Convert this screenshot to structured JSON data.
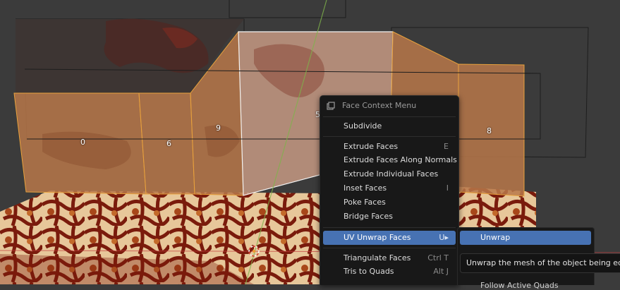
{
  "viewport": {
    "face_labels": [
      "0",
      "6",
      "9",
      "5",
      "8"
    ],
    "colors": {
      "selection": "#e0a040",
      "background": "#3b3b3b",
      "menu_bg": "#181818",
      "highlight": "#4772b3"
    }
  },
  "context_menu": {
    "title": "Face Context Menu",
    "title_icon": "window-icon",
    "items": [
      {
        "label": "Subdivide",
        "shortcut": ""
      },
      {
        "label": "Extrude Faces",
        "shortcut": "E"
      },
      {
        "label": "Extrude Faces Along Normals",
        "shortcut": ""
      },
      {
        "label": "Extrude Individual Faces",
        "shortcut": ""
      },
      {
        "label": "Inset Faces",
        "shortcut": "I"
      },
      {
        "label": "Poke Faces",
        "shortcut": ""
      },
      {
        "label": "Bridge Faces",
        "shortcut": ""
      },
      {
        "label": "UV Unwrap Faces",
        "shortcut": "U▸"
      },
      {
        "label": "Triangulate Faces",
        "shortcut": "Ctrl T"
      },
      {
        "label": "Tris to Quads",
        "shortcut": "Alt J"
      }
    ]
  },
  "submenu": {
    "items": [
      {
        "label": "Unwrap"
      },
      {
        "label": "Follow Active Quads"
      }
    ]
  },
  "tooltip": {
    "text": "Unwrap the mesh of the object being edited."
  }
}
